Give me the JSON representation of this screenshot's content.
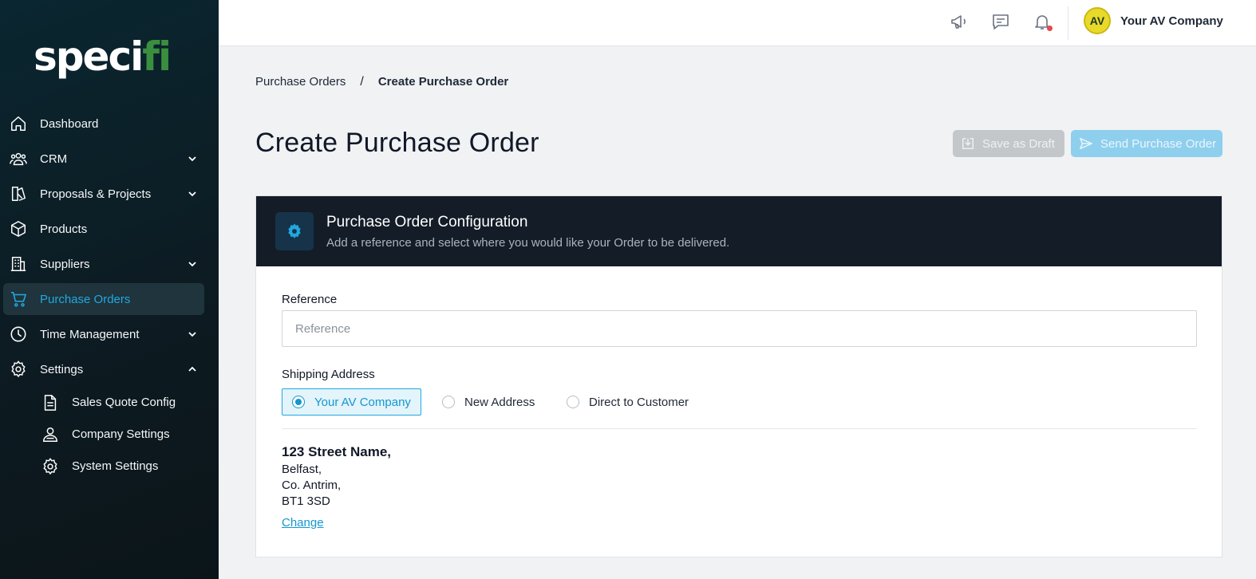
{
  "app": {
    "logo_text_main": "speci",
    "logo_text_accent": "fi"
  },
  "sidebar": {
    "items": [
      {
        "label": "Dashboard",
        "icon": "home-icon"
      },
      {
        "label": "CRM",
        "icon": "users-icon",
        "expand": "collapsed"
      },
      {
        "label": "Proposals & Projects",
        "icon": "proposal-icon",
        "expand": "collapsed"
      },
      {
        "label": "Products",
        "icon": "box-icon"
      },
      {
        "label": "Suppliers",
        "icon": "building-icon",
        "expand": "collapsed"
      },
      {
        "label": "Purchase Orders",
        "icon": "cart-icon",
        "active": true
      },
      {
        "label": "Time Management",
        "icon": "clock-icon",
        "expand": "collapsed"
      },
      {
        "label": "Settings",
        "icon": "gear-icon",
        "expand": "expanded"
      }
    ],
    "settings_sub": [
      {
        "label": "Sales Quote Config",
        "icon": "document-icon"
      },
      {
        "label": "Company Settings",
        "icon": "team-icon"
      },
      {
        "label": "System Settings",
        "icon": "gear-icon"
      }
    ]
  },
  "topbar": {
    "avatar_initials": "AV",
    "company_name": "Your AV Company",
    "icons": [
      "megaphone-icon",
      "chat-icon",
      "bell-icon"
    ],
    "notification_dot_color": "#e5484d"
  },
  "breadcrumb": {
    "parent": "Purchase Orders",
    "separator": "/",
    "current": "Create Purchase Order"
  },
  "page": {
    "title": "Create Purchase Order",
    "save_draft_label": "Save as Draft",
    "send_label": "Send Purchase Order"
  },
  "config_card": {
    "title": "Purchase Order Configuration",
    "subtitle": "Add a reference and select where you would like your Order to be delivered.",
    "reference_label": "Reference",
    "reference_placeholder": "Reference",
    "reference_value": "",
    "shipping_label": "Shipping Address",
    "shipping_options": [
      {
        "label": "Your AV Company",
        "selected": true
      },
      {
        "label": "New Address",
        "selected": false
      },
      {
        "label": "Direct to Customer",
        "selected": false
      }
    ],
    "address": {
      "line1": "123 Street Name,",
      "line2": "Belfast,",
      "line3": "Co. Antrim,",
      "line4": "BT1 3SD"
    },
    "change_label": "Change"
  },
  "colors": {
    "accent": "#21a8e0",
    "sidebar_bg": "#0d1b22",
    "header_bg": "#131c27",
    "avatar_bg": "#e8d92a"
  }
}
